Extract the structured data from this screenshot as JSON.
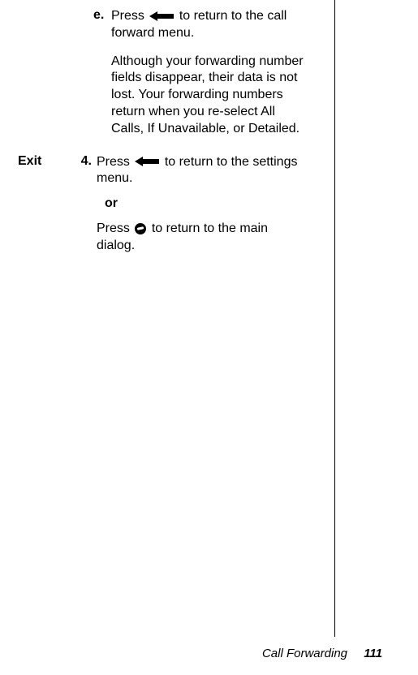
{
  "itemE": {
    "letter": "e.",
    "press": "Press",
    "afterIcon": "to return to the call forward menu.",
    "note": "Although your forwarding number fields disappear, their data is not lost. Your forwarding numbers return when you re-select All Calls, If Unavailable, or Detailed."
  },
  "exit": {
    "label": "Exit",
    "num": "4.",
    "press": "Press",
    "afterIcon": "to return to the settings menu.",
    "or": "or",
    "press2": "Press",
    "afterIcon2": "to return to the main dialog."
  },
  "footer": {
    "section": "Call Forwarding",
    "page": "111"
  }
}
